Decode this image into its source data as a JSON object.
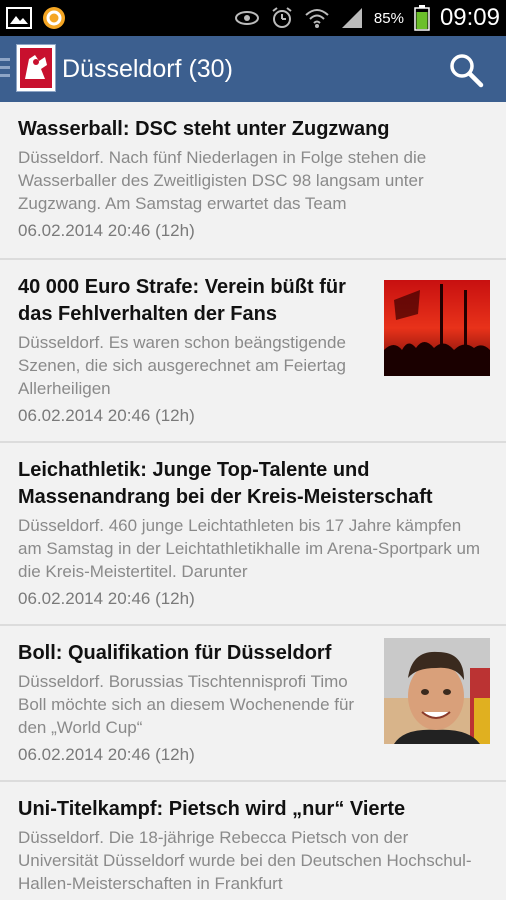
{
  "status_bar": {
    "battery": "85%",
    "time": "09:09"
  },
  "action_bar": {
    "title": "Düsseldorf (30)"
  },
  "articles": [
    {
      "title": "Wasserball: DSC steht unter Zugzwang",
      "snippet": "Düsseldorf. Nach fünf Niederlagen in Folge stehen die Wasserballer des Zweitligisten DSC 98 langsam unter Zugzwang. Am Samstag erwartet das Team",
      "date": "06.02.2014 20:46 (12h)"
    },
    {
      "title": "40 000 Euro Strafe: Verein büßt für das Fehlverhalten der Fans",
      "snippet": "Düsseldorf. Es waren schon beängstigende Szenen, die sich ausgerechnet am Feiertag Allerheiligen",
      "date": "06.02.2014 20:46 (12h)"
    },
    {
      "title": "Leichathletik: Junge Top-Talente und Massenandrang bei der Kreis-Meisterschaft",
      "snippet": "Düsseldorf. 460 junge Leichtathleten bis 17 Jahre kämpfen am Samstag in der Leichtathletikhalle im Arena-Sportpark um die Kreis-Meistertitel. Darunter",
      "date": "06.02.2014 20:46 (12h)"
    },
    {
      "title": "Boll: Qualifikation für Düsseldorf",
      "snippet": "Düsseldorf. Borussias Tischtennisprofi Timo Boll möchte sich an diesem Wochenende für den „World Cup“",
      "date": "06.02.2014 20:46 (12h)"
    },
    {
      "title": "Uni-Titelkampf: Pietsch wird „nur“ Vierte",
      "snippet": "Düsseldorf. Die 18-jährige Rebecca Pietsch von der Universität Düsseldorf wurde bei den Deutschen Hochschul-Hallen-Meisterschaften in Frankfurt",
      "date": ""
    }
  ]
}
